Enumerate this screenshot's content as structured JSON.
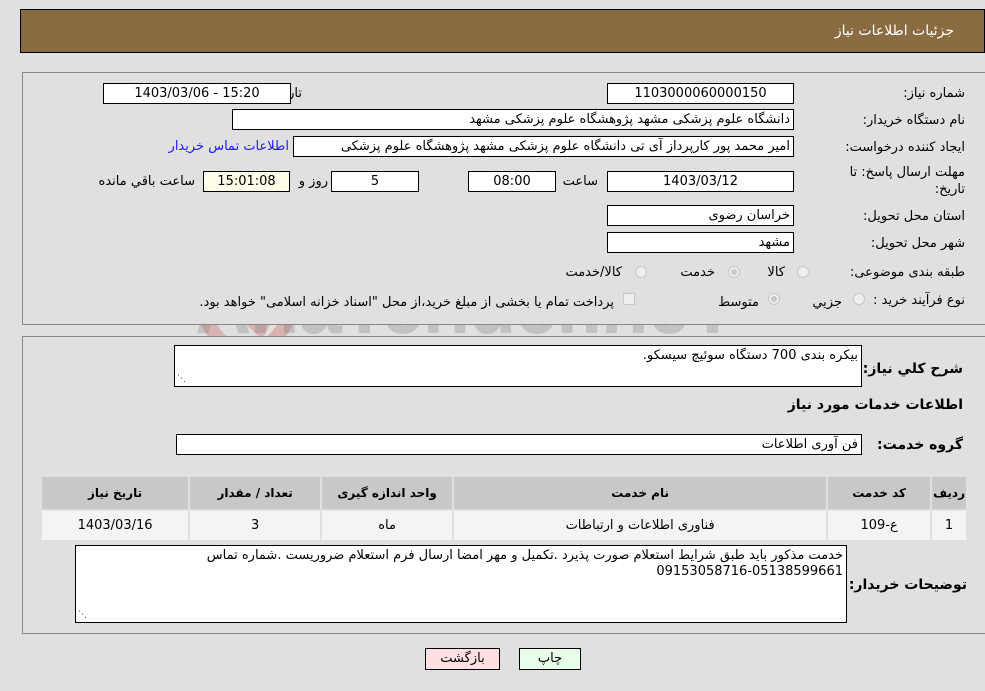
{
  "header": {
    "title": "جزئیات اطلاعات نیاز"
  },
  "details": {
    "need_number_label": "شماره نیاز:",
    "need_number": "1103000060000150",
    "announce_label": "تاریخ و ساعت اعلان عمومي:",
    "announce_value": "1403/03/06 - 15:20",
    "buyer_org_label": "نام دستگاه خریدار:",
    "buyer_org": "دانشگاه علوم پزشکی مشهد   پژوهشگاه علوم پزشکی مشهد",
    "creator_label": "ایجاد کننده درخواست:",
    "creator": "امیر محمد پور کارپرداز آی تی دانشگاه علوم پزشکی مشهد   پژوهشگاه علوم پزشکی",
    "contact_link": "اطلاعات تماس خریدار",
    "deadline_label_1": "مهلت ارسال پاسخ: تا",
    "deadline_label_2": "تاریخ:",
    "deadline_date": "1403/03/12",
    "time_label": "ساعت",
    "deadline_time": "08:00",
    "days_value": "5",
    "days_label": "روز و",
    "remaining_time": "15:01:08",
    "remaining_label": "ساعت باقي مانده",
    "province_label": "استان محل تحویل:",
    "province": "خراسان رضوی",
    "city_label": "شهر محل تحویل:",
    "city": "مشهد",
    "category_label": "طبقه بندی موضوعی:",
    "category_options": [
      {
        "label": "کالا",
        "checked": false
      },
      {
        "label": "خدمت",
        "checked": true
      },
      {
        "label": "کالا/خدمت",
        "checked": false
      }
    ],
    "process_label": "نوع فرآیند خرید :",
    "process_options": [
      {
        "label": "جزيي",
        "checked": false
      },
      {
        "label": "متوسط",
        "checked": true
      }
    ],
    "treasury_note": "پرداخت تمام یا بخشی از مبلغ خرید،از محل \"اسناد خزانه اسلامی\" خواهد بود."
  },
  "summary": {
    "description_label": "شرح کلي نياز:",
    "description": "بیکره بندی 700 دستگاه سوئیچ سیسکو.",
    "services_title": "اطلاعات خدمات مورد نیاز",
    "service_group_label": "گروه خدمت:",
    "service_group": "فن آوری اطلاعات"
  },
  "table": {
    "headers": [
      "ردیف",
      "کد خدمت",
      "نام خدمت",
      "واحد اندازه گیری",
      "تعداد / مقدار",
      "تاریخ نیاز"
    ],
    "rows": [
      [
        "1",
        "ع-109",
        "فناوری اطلاعات و ارتباطات",
        "ماه",
        "3",
        "1403/03/16"
      ]
    ]
  },
  "buyer_notes": {
    "label": "توضیحات خریدار:",
    "text_line1": "خدمت مذکور باید طبق شرایط استعلام صورت پذیرد .تکمیل و مهر امضا ارسال فرم استعلام ضروریست .شماره تماس",
    "text_line2": "09153058716-05138599661"
  },
  "buttons": {
    "print": "چاپ",
    "back": "بازگشت"
  },
  "watermark": "AriaTender.neT",
  "colors": {
    "header_bg": "#8b6c42",
    "link": "#1a1aff",
    "print_bg": "#eaffea",
    "back_bg": "#ffe0e0",
    "remaining_bg": "#ffffe8"
  }
}
